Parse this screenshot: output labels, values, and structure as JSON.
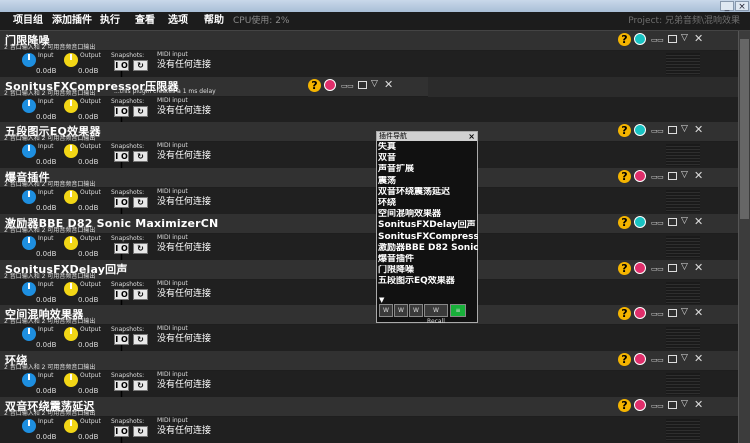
{
  "window": {
    "min": "_",
    "close": "×"
  },
  "menu": {
    "items": [
      "项目组",
      "添加插件",
      "执行",
      "查看",
      "选项",
      "帮助"
    ],
    "cpu": "CPU使用: 2%",
    "project": "Project: 兄弟音频\\混响效果"
  },
  "common": {
    "input_label": "Input",
    "output_label": "Output",
    "snapshots_label": "Snapshots:",
    "midi_label": "MIDI input",
    "midi_value": "没有任何连接",
    "input_value": "0.0dB",
    "output_value": "0.0dB",
    "io_text": "2 音口输入和 2 可用音频音口输出",
    "snap_button_1": "I O I",
    "snap_button_2": "↻"
  },
  "plugins": [
    {
      "name": "门限降噪",
      "note": "",
      "power": "teal",
      "narrow": false
    },
    {
      "name": "SonitusFXCompressor压限器",
      "note": "...this plugin creates a 1 ms delay",
      "power": "pink",
      "narrow": true
    },
    {
      "name": "五段图示EQ效果器",
      "note": "",
      "power": "teal",
      "narrow": false
    },
    {
      "name": "爆音插件",
      "note": "",
      "power": "pink",
      "narrow": false
    },
    {
      "name": "激励器BBE D82 Sonic MaximizerCN",
      "note": "",
      "power": "teal",
      "narrow": false
    },
    {
      "name": "SonitusFXDelay回声",
      "note": "",
      "power": "pink",
      "narrow": false
    },
    {
      "name": "空间混响效果器",
      "note": "",
      "power": "pink",
      "narrow": false
    },
    {
      "name": "环绕",
      "note": "",
      "power": "pink",
      "narrow": false
    },
    {
      "name": "双音环绕震荡延迟",
      "note": "",
      "power": "pink",
      "narrow": false
    }
  ],
  "header_icons": {
    "help": "?",
    "edit": "▭▭",
    "collapse": "▽",
    "close": "✕"
  },
  "navigator": {
    "title": "插件导航",
    "close": "×",
    "items": [
      "失真",
      "双音",
      "声音扩展",
      "震荡",
      "双音环绕震荡延迟",
      "环绕",
      "空间混响效果器",
      "SonitusFXDelay回声",
      "SonitusFXCompressor压限器",
      "激励器BBE D82 Sonic MaximizerCN",
      "爆音插件",
      "门限降噪",
      "五段图示EQ效果器"
    ],
    "arrow": "▼",
    "tools": [
      "W",
      "W",
      "W",
      "W Recall",
      "≡"
    ]
  }
}
